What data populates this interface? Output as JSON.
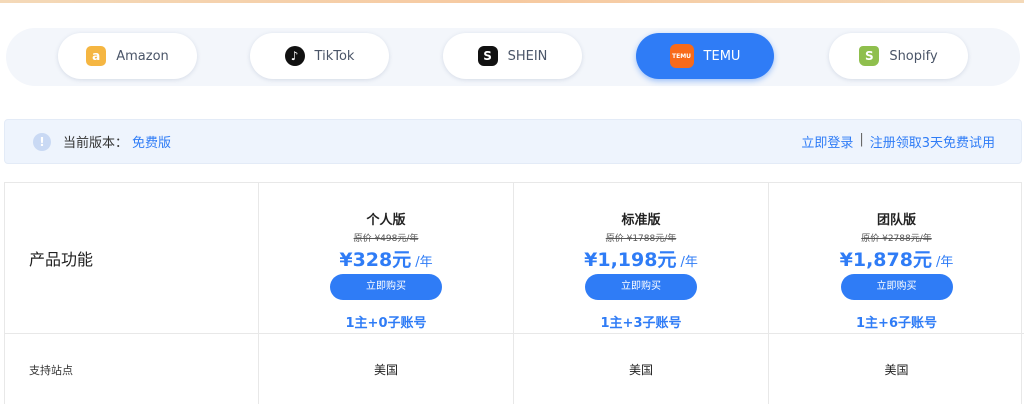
{
  "platforms": [
    {
      "label": "Amazon",
      "icon": "amazon-logo-icon",
      "glyph": "a",
      "active": false
    },
    {
      "label": "TikTok",
      "icon": "tiktok-logo-icon",
      "glyph": "♪",
      "active": false
    },
    {
      "label": "SHEIN",
      "icon": "shein-logo-icon",
      "glyph": "S",
      "active": false
    },
    {
      "label": "TEMU",
      "icon": "temu-logo-icon",
      "glyph": "TEMU",
      "active": true
    },
    {
      "label": "Shopify",
      "icon": "shopify-logo-icon",
      "glyph": "S",
      "active": false
    }
  ],
  "version": {
    "label": "当前版本：",
    "value": "免费版",
    "login": "立即登录",
    "separator": "|",
    "register": "注册领取3天免费试用"
  },
  "table": {
    "feature_header": "产品功能",
    "plans": [
      {
        "name": "个人版",
        "original": "原价 ¥498元/年",
        "price": "¥328元",
        "unit": "/年",
        "buy": "立即购买",
        "accounts": "1主+0子账号"
      },
      {
        "name": "标准版",
        "original": "原价 ¥1788元/年",
        "price": "¥1,198元",
        "unit": "/年",
        "buy": "立即购买",
        "accounts": "1主+3子账号"
      },
      {
        "name": "团队版",
        "original": "原价 ¥2788元/年",
        "price": "¥1,878元",
        "unit": "/年",
        "buy": "立即购买",
        "accounts": "1主+6子账号"
      }
    ],
    "rows": [
      {
        "label": "支持站点",
        "values": [
          "美国",
          "美国",
          "美国"
        ]
      }
    ]
  },
  "colors": {
    "accent": "#2f7cf6",
    "temu": "#f86a1a"
  }
}
